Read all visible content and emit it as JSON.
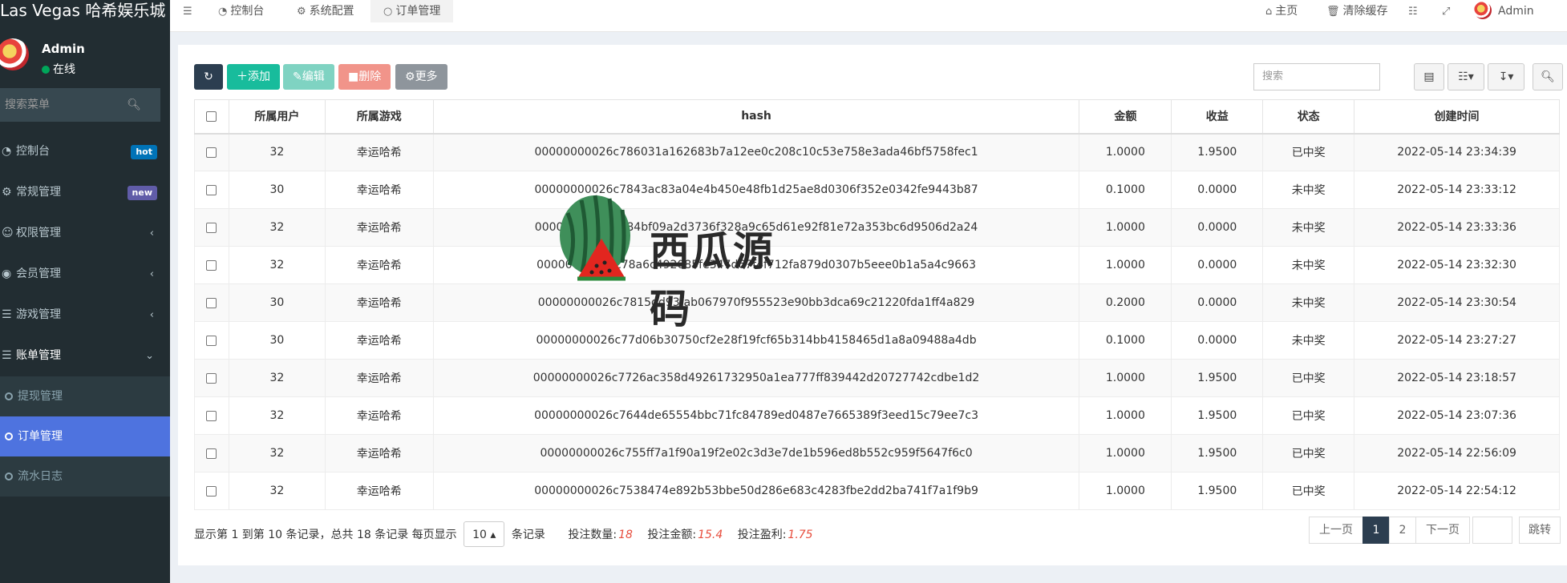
{
  "brand": "Las Vegas 哈希娱乐城",
  "user": {
    "name": "Admin",
    "status": "在线"
  },
  "sidebar": {
    "search_placeholder": "搜索菜单",
    "items": [
      {
        "label": "控制台",
        "icon": "dashboard-icon",
        "badge": "hot"
      },
      {
        "label": "常规管理",
        "icon": "cogs-icon",
        "badge": "new"
      },
      {
        "label": "权限管理",
        "icon": "group-icon"
      },
      {
        "label": "会员管理",
        "icon": "user-circle-icon"
      },
      {
        "label": "游戏管理",
        "icon": "list-icon"
      },
      {
        "label": "账单管理",
        "icon": "list-icon"
      }
    ],
    "sub_items": [
      {
        "label": "提现管理"
      },
      {
        "label": "订单管理"
      },
      {
        "label": "流水日志"
      }
    ]
  },
  "topbar": {
    "tabs": [
      {
        "label": "控制台"
      },
      {
        "label": "系统配置"
      },
      {
        "label": "订单管理"
      }
    ],
    "home": "主页",
    "clear_cache": "清除缓存",
    "admin": "Admin"
  },
  "toolbar": {
    "add": "添加",
    "edit": "编辑",
    "delete": "删除",
    "more": "更多",
    "search_placeholder": "搜索"
  },
  "table": {
    "columns": [
      "所属用户",
      "所属游戏",
      "hash",
      "金额",
      "收益",
      "状态",
      "创建时间"
    ],
    "rows": [
      {
        "user": "32",
        "game": "幸运哈希",
        "hash": "00000000026c786031a162683b7a12ee0c208c10c53e758e3ada46bf5758fec1",
        "amount": "1.0000",
        "profit": "1.9500",
        "status": "已中奖",
        "time": "2022-05-14 23:34:39"
      },
      {
        "user": "30",
        "game": "幸运哈希",
        "hash": "00000000026c7843ac83a04e4b450e48fb1d25ae8d0306f352e0342fe9443b87",
        "amount": "0.1000",
        "profit": "0.0000",
        "status": "未中奖",
        "time": "2022-05-14 23:33:12"
      },
      {
        "user": "32",
        "game": "幸运哈希",
        "hash": "00000000026c784bf09a2d3736f328a9c65d61e92f81e72a353bc6d9506d2a24",
        "amount": "1.0000",
        "profit": "0.0000",
        "status": "未中奖",
        "time": "2022-05-14 23:33:36"
      },
      {
        "user": "32",
        "game": "幸运哈希",
        "hash": "00000000026c78a6c492085fe347d67f4f712fa879d0307b5eee0b1a5a4c9663",
        "amount": "1.0000",
        "profit": "0.0000",
        "status": "未中奖",
        "time": "2022-05-14 23:32:30"
      },
      {
        "user": "30",
        "game": "幸运哈希",
        "hash": "00000000026c7815dd93fab067970f955523e90bb3dca69c21220fda1ff4a829",
        "amount": "0.2000",
        "profit": "0.0000",
        "status": "未中奖",
        "time": "2022-05-14 23:30:54"
      },
      {
        "user": "30",
        "game": "幸运哈希",
        "hash": "00000000026c77d06b30750cf2e28f19fcf65b314bb4158465d1a8a09488a4db",
        "amount": "0.1000",
        "profit": "0.0000",
        "status": "未中奖",
        "time": "2022-05-14 23:27:27"
      },
      {
        "user": "32",
        "game": "幸运哈希",
        "hash": "00000000026c7726ac358d49261732950a1ea777ff839442d20727742cdbe1d2",
        "amount": "1.0000",
        "profit": "1.9500",
        "status": "已中奖",
        "time": "2022-05-14 23:18:57"
      },
      {
        "user": "32",
        "game": "幸运哈希",
        "hash": "00000000026c7644de65554bbc71fc84789ed0487e7665389f3eed15c79ee7c3",
        "amount": "1.0000",
        "profit": "1.9500",
        "status": "已中奖",
        "time": "2022-05-14 23:07:36"
      },
      {
        "user": "32",
        "game": "幸运哈希",
        "hash": "00000000026c755ff7a1f90a19f2e02c3d3e7de1b596ed8b552c959f5647f6c0",
        "amount": "1.0000",
        "profit": "1.9500",
        "status": "已中奖",
        "time": "2022-05-14 22:56:09"
      },
      {
        "user": "32",
        "game": "幸运哈希",
        "hash": "00000000026c7538474e892b53bbe50d286e683c4283fbe2dd2ba741f7a1f9b9",
        "amount": "1.0000",
        "profit": "1.9500",
        "status": "已中奖",
        "time": "2022-05-14 22:54:12"
      }
    ]
  },
  "footer": {
    "summary_prefix": "显示第 1 到第 10 条记录，总共 18 条记录 每页显示",
    "page_size": "10",
    "summary_suffix": "条记录",
    "bet_count_label": "投注数量:",
    "bet_count": "18",
    "bet_amount_label": "投注金额:",
    "bet_amount": "15.4",
    "bet_profit_label": "投注盈利:",
    "bet_profit": "1.75"
  },
  "pagination": {
    "prev": "上一页",
    "pages": [
      "1",
      "2"
    ],
    "current": "1",
    "next": "下一页",
    "jump": "跳转"
  },
  "watermark": "西瓜源码",
  "colors": {
    "sidebar_bg": "#222d32",
    "active_menu": "#4e73df",
    "add_btn": "#18bc9c",
    "win": "#e74c3c",
    "lose": "#f39c12"
  }
}
